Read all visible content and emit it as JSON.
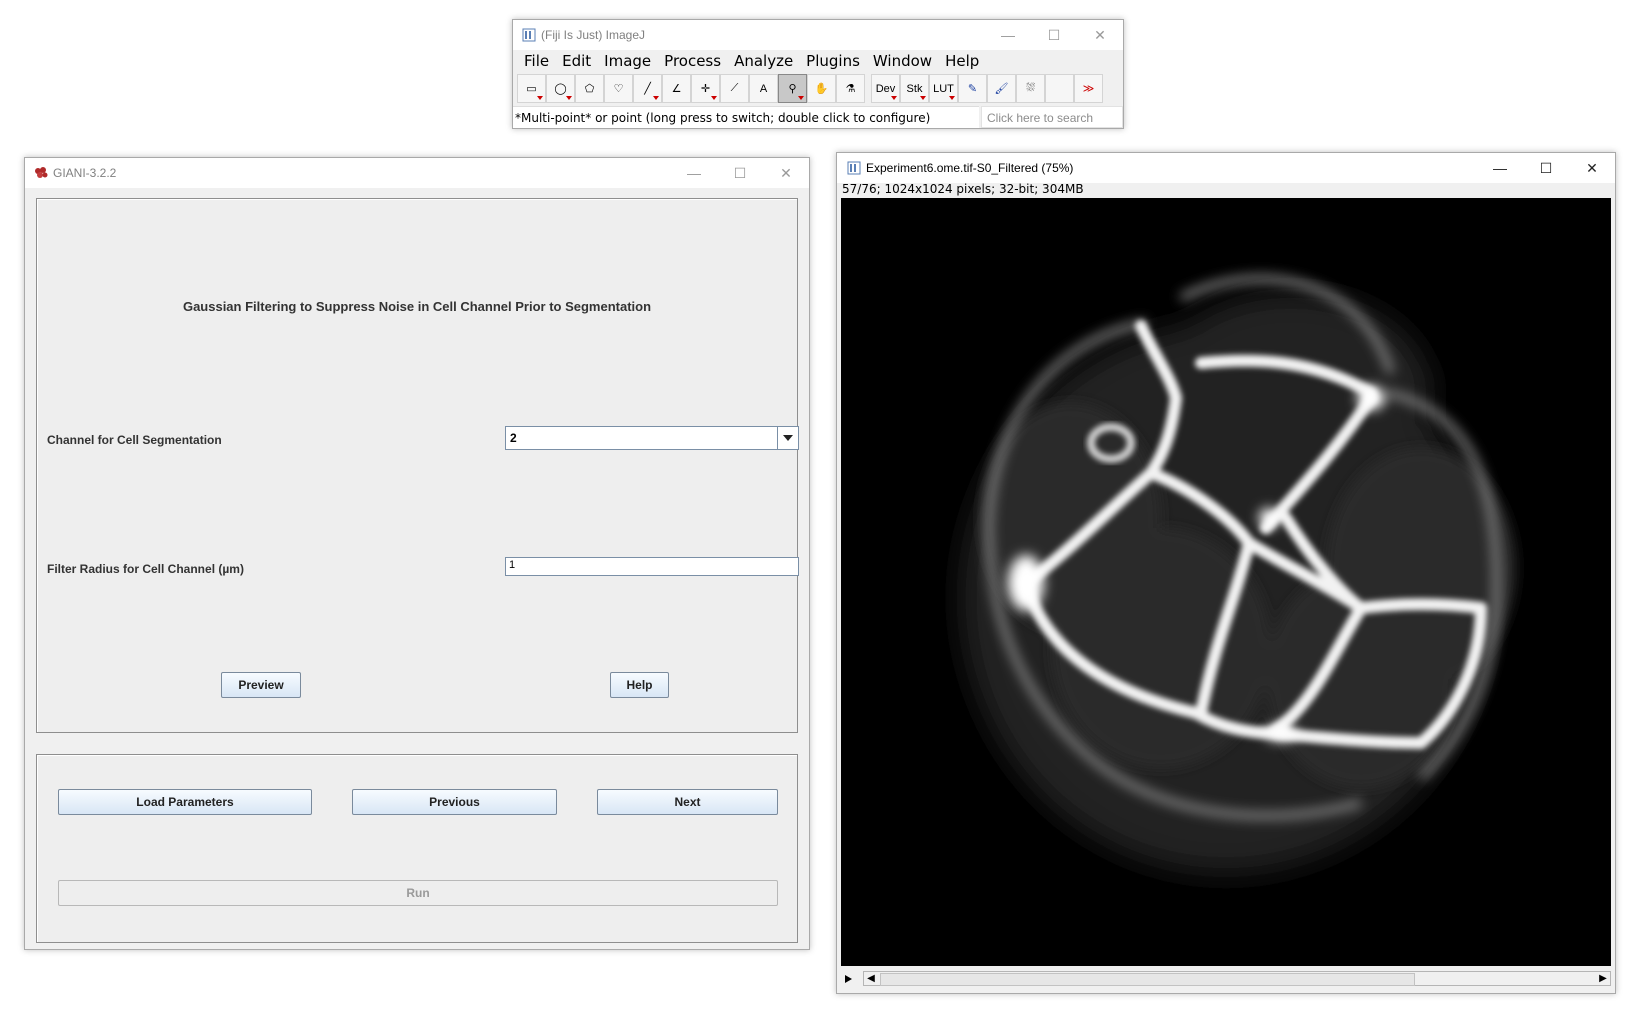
{
  "imagej": {
    "title": "(Fiji Is Just) ImageJ",
    "menus": [
      "File",
      "Edit",
      "Image",
      "Process",
      "Analyze",
      "Plugins",
      "Window",
      "Help"
    ],
    "tools": [
      {
        "name": "rectangle-tool-icon",
        "glyph": "▭"
      },
      {
        "name": "oval-tool-icon",
        "glyph": "◯"
      },
      {
        "name": "polygon-tool-icon",
        "glyph": "⬠"
      },
      {
        "name": "freehand-tool-icon",
        "glyph": "♡"
      },
      {
        "name": "line-tool-icon",
        "glyph": "╱"
      },
      {
        "name": "angle-tool-icon",
        "glyph": "∠"
      },
      {
        "name": "point-tool-icon",
        "glyph": "✛"
      },
      {
        "name": "wand-tool-icon",
        "glyph": "⟋"
      },
      {
        "name": "text-tool-icon",
        "glyph": "A"
      },
      {
        "name": "magnifier-tool-icon",
        "glyph": "⚲"
      },
      {
        "name": "hand-tool-icon",
        "glyph": "✋"
      },
      {
        "name": "dropper-tool-icon",
        "glyph": "⚗"
      }
    ],
    "extra_tools": [
      {
        "name": "dev-menu-icon",
        "glyph": "Dev"
      },
      {
        "name": "stk-menu-icon",
        "glyph": "Stk"
      },
      {
        "name": "lut-menu-icon",
        "glyph": "LUT"
      },
      {
        "name": "pencil-tool-icon",
        "glyph": "✎"
      },
      {
        "name": "brush-tool-icon",
        "glyph": "🖌"
      },
      {
        "name": "flood-fill-tool-icon",
        "glyph": "⛆"
      },
      {
        "name": "empty-tool-slot-icon",
        "glyph": ""
      },
      {
        "name": "more-tools-icon",
        "glyph": "≫"
      }
    ],
    "status": "*Multi-point* or point (long press to switch; double click to configure)",
    "search_placeholder": "Click here to search"
  },
  "giani": {
    "title": "GIANI-3.2.2",
    "heading": "Gaussian Filtering to Suppress Noise in Cell Channel Prior to Segmentation",
    "channel_label": "Channel for Cell Segmentation",
    "channel_value": "2",
    "radius_label": "Filter Radius for Cell Channel (µm)",
    "radius_value": "1",
    "preview_label": "Preview",
    "help_label": "Help",
    "load_label": "Load Parameters",
    "previous_label": "Previous",
    "next_label": "Next",
    "run_label": "Run"
  },
  "image_window": {
    "title": "Experiment6.ome.tif-S0_Filtered (75%)",
    "info": "57/76; 1024x1024 pixels; 32-bit; 304MB",
    "slice_position": 0.74
  },
  "colors": {
    "accent_button": "#d8e6f5",
    "active_tool": "#c8c8c8",
    "red_marker": "#cc0000"
  }
}
